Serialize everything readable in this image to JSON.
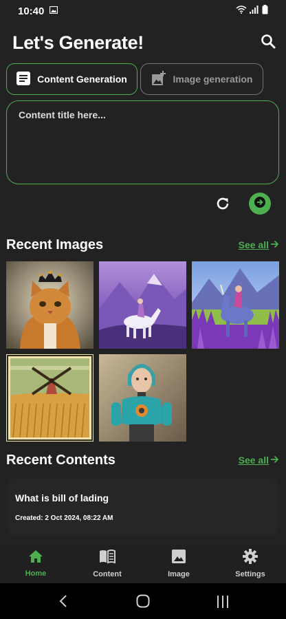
{
  "status_bar": {
    "time": "10:40"
  },
  "header": {
    "title": "Let's Generate!"
  },
  "tabs": [
    {
      "label": "Content Generation",
      "active": true
    },
    {
      "label": "Image generation",
      "active": false
    }
  ],
  "content_input": {
    "placeholder": "Content title here...",
    "value": ""
  },
  "recent_images": {
    "title": "Recent Images",
    "see_all": "See all",
    "items": [
      "cat-with-crown",
      "girl-on-white-horse",
      "girl-on-unicorn",
      "windmill-wheat-field",
      "robot-girl"
    ]
  },
  "recent_contents": {
    "title": "Recent Contents",
    "see_all": "See all",
    "items": [
      {
        "title": "What is bill of lading",
        "created": "Created: 2 Oct 2024, 08:22 AM"
      }
    ]
  },
  "bottom_nav": [
    {
      "label": "Home",
      "icon": "home-icon",
      "active": true
    },
    {
      "label": "Content",
      "icon": "book-icon",
      "active": false
    },
    {
      "label": "Image",
      "icon": "image-icon",
      "active": false
    },
    {
      "label": "Settings",
      "icon": "gear-icon",
      "active": false
    }
  ],
  "colors": {
    "background": "#222222",
    "accent": "#4caf50",
    "inactive_border": "#777777"
  }
}
